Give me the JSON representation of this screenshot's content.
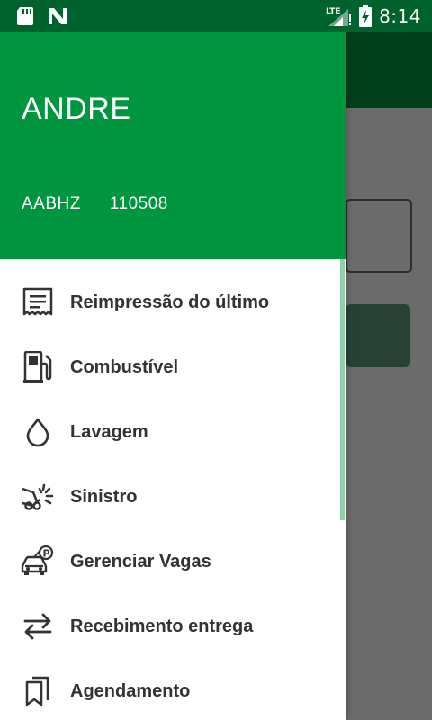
{
  "status_bar": {
    "time": "8:14",
    "network": "LTE",
    "icons": [
      "sd-card-icon",
      "n-notification-icon",
      "lte-signal-icon",
      "battery-charging-icon"
    ]
  },
  "drawer": {
    "user_name": "ANDRE",
    "user_code": "AABHZ",
    "user_id": "110508",
    "menu": [
      {
        "label": "Reimpressão do último",
        "icon": "receipt-icon"
      },
      {
        "label": "Combustível",
        "icon": "fuel-pump-icon"
      },
      {
        "label": "Lavagem",
        "icon": "water-drop-icon"
      },
      {
        "label": "Sinistro",
        "icon": "car-crash-icon"
      },
      {
        "label": "Gerenciar Vagas",
        "icon": "parking-car-icon"
      },
      {
        "label": "Recebimento entrega",
        "icon": "swap-arrows-icon"
      },
      {
        "label": "Agendamento",
        "icon": "bookmarks-icon"
      }
    ]
  },
  "colors": {
    "primary": "#009640",
    "primary_dark": "#00622d",
    "scroll_indicator": "#8fd0a6",
    "menu_text": "#333333"
  }
}
